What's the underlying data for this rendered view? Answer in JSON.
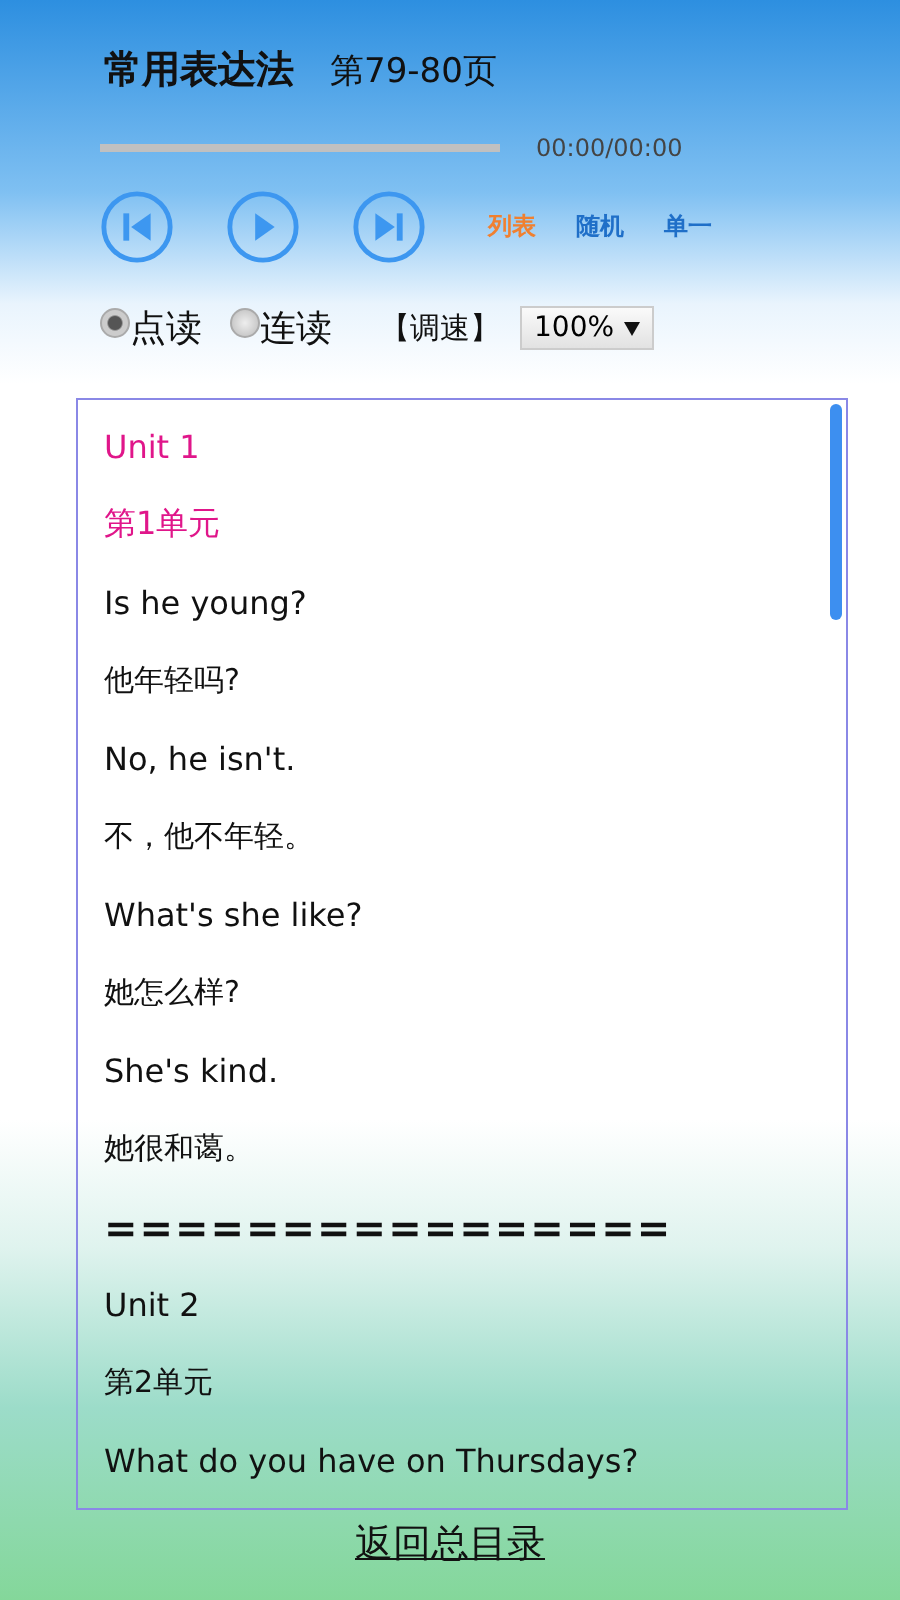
{
  "header": {
    "title": "常用表达法",
    "pages": "第79-80页"
  },
  "player": {
    "time": "00:00/00:00"
  },
  "play_modes": [
    {
      "label": "列表",
      "selected": true
    },
    {
      "label": "随机",
      "selected": false
    },
    {
      "label": "单一",
      "selected": false
    }
  ],
  "read_modes": [
    {
      "label": "点读",
      "selected": true
    },
    {
      "label": "连读",
      "selected": false
    }
  ],
  "speed": {
    "label": "【调速】",
    "value": "100%"
  },
  "lines": [
    {
      "text": "Unit 1",
      "kind": "heading"
    },
    {
      "text": "第1单元",
      "kind": "heading"
    },
    {
      "text": "Is he young?",
      "kind": "english"
    },
    {
      "text": "他年轻吗?",
      "kind": "chinese"
    },
    {
      "text": "No, he isn't.",
      "kind": "english"
    },
    {
      "text": "不，他不年轻。",
      "kind": "chinese"
    },
    {
      "text": "What's she like?",
      "kind": "english"
    },
    {
      "text": "她怎么样?",
      "kind": "chinese"
    },
    {
      "text": "She's kind.",
      "kind": "english"
    },
    {
      "text": "她很和蔼。",
      "kind": "chinese"
    },
    {
      "text": "================",
      "kind": "separator"
    },
    {
      "text": "Unit 2",
      "kind": "english"
    },
    {
      "text": "第2单元",
      "kind": "chinese"
    },
    {
      "text": "What do you have on Thursdays?",
      "kind": "english"
    }
  ],
  "back_link": "返回总目录"
}
